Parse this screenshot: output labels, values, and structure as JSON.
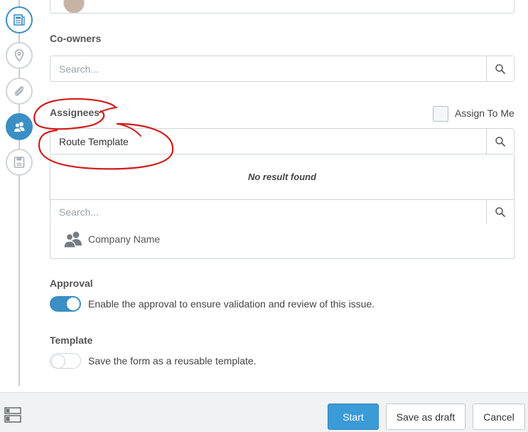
{
  "coowners": {
    "label": "Co-owners",
    "placeholder": "Search..."
  },
  "assignees": {
    "label": "Assignees",
    "assign_to_me": "Assign To Me",
    "search_value": "Route Template",
    "no_result": "No result found",
    "second_search_placeholder": "Search...",
    "company_name": "Company Name"
  },
  "approval": {
    "label": "Approval",
    "toggle_on": true,
    "description": "Enable the approval to ensure validation and review of this issue."
  },
  "template": {
    "label": "Template",
    "toggle_on": false,
    "description": "Save the form as a reusable template."
  },
  "footer": {
    "start": "Start",
    "save_draft": "Save as draft",
    "cancel": "Cancel"
  },
  "steps": [
    {
      "icon": "form-icon",
      "state": "done"
    },
    {
      "icon": "location-pin-icon",
      "state": "pending"
    },
    {
      "icon": "paperclip-icon",
      "state": "pending"
    },
    {
      "icon": "users-icon",
      "state": "active"
    },
    {
      "icon": "save-icon",
      "state": "pending"
    }
  ],
  "colors": {
    "accent": "#3b8fc4",
    "annotation": "#d21d1d"
  }
}
